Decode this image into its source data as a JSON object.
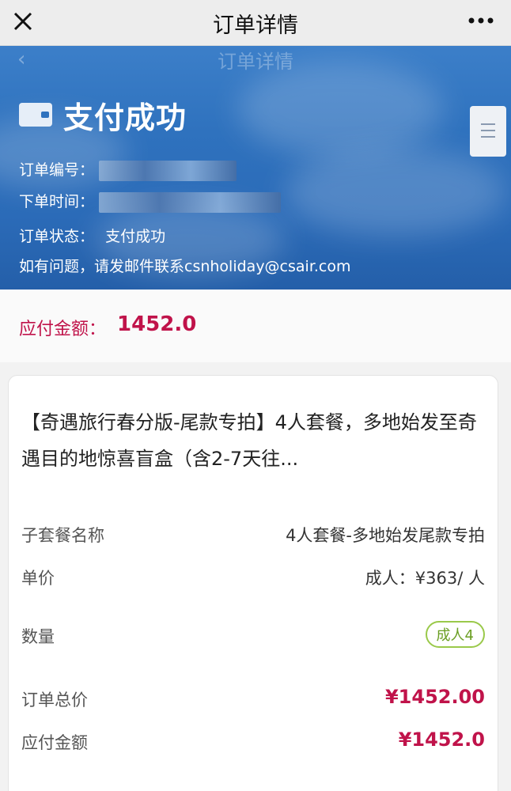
{
  "topbar": {
    "title": "订单详情",
    "close_icon": "close-icon",
    "more_icon": "more-dots-icon"
  },
  "header": {
    "ghost_back": "‹",
    "ghost_title": "订单详情",
    "status_icon": "wallet-icon",
    "status_title": "支付成功",
    "order_no_label": "订单编号：",
    "order_time_label": "下单时间：",
    "order_status_label": "订单状态：",
    "order_status_value": "支付成功",
    "contact_text": "如有问题，请发邮件联系csnholiday@csair.com",
    "side_handle_icon": "scroll-handle-icon"
  },
  "amount": {
    "label": "应付金额：",
    "value": "1452.0"
  },
  "card": {
    "product_title": "【奇遇旅行春分版-尾款专拍】4人套餐，多地始发至奇遇目的地惊喜盲盒（含2-7天往...",
    "rows": [
      {
        "key": "子套餐名称",
        "value": "4人套餐-多地始发尾款专拍"
      },
      {
        "key": "单价",
        "value": "成人：¥363/ 人"
      },
      {
        "key": "数量",
        "value": "成人4"
      },
      {
        "key": "订单总价",
        "value": "¥1452.00"
      },
      {
        "key": "应付金额",
        "value": "¥1452.0"
      }
    ]
  },
  "colors": {
    "accent_red": "#c0134a",
    "header_blue": "#2f72be",
    "badge_green": "#9ac94a"
  }
}
